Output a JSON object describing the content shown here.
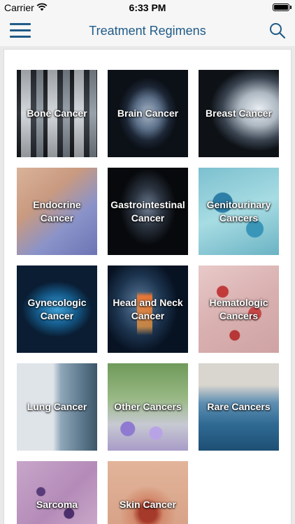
{
  "status_bar": {
    "carrier": "Carrier",
    "time": "6:33 PM",
    "wifi_icon": "wifi-icon",
    "battery_icon": "battery-icon"
  },
  "navbar": {
    "title": "Treatment Regimens",
    "menu_icon": "hamburger-menu-icon",
    "search_icon": "search-icon",
    "accent_color": "#1f5b88"
  },
  "categories": [
    {
      "label": "Bone Cancer"
    },
    {
      "label": "Brain Cancer"
    },
    {
      "label": "Breast Cancer"
    },
    {
      "label": "Endocrine Cancer"
    },
    {
      "label": "Gastrointestinal Cancer"
    },
    {
      "label": "Genitourinary Cancers"
    },
    {
      "label": "Gynecologic Cancer"
    },
    {
      "label": "Head and Neck Cancer"
    },
    {
      "label": "Hematologic Cancers"
    },
    {
      "label": "Lung Cancer"
    },
    {
      "label": "Other Cancers"
    },
    {
      "label": "Rare Cancers"
    },
    {
      "label": "Sarcoma"
    },
    {
      "label": "Skin Cancer"
    }
  ]
}
